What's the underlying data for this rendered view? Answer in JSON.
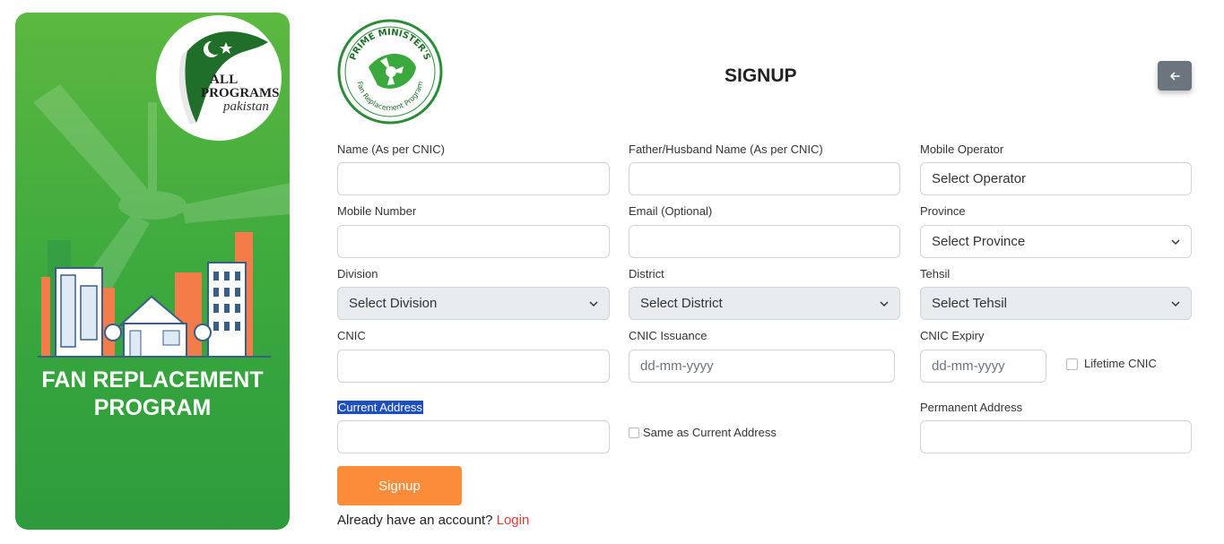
{
  "sidebar": {
    "logo_line1": "ALL",
    "logo_line2": "PROGRAMS",
    "logo_line3": "pakistan",
    "title_line1": "FAN REPLACEMENT",
    "title_line2": "PROGRAM"
  },
  "brand": {
    "ring_top": "PRIME MINISTER'S",
    "ring_bottom": "Fan Replacement Program"
  },
  "header": {
    "title": "SIGNUP",
    "back_icon": "arrow-left-icon"
  },
  "form": {
    "name_label": "Name (As per CNIC)",
    "father_label": "Father/Husband Name (As per CNIC)",
    "operator_label": "Mobile Operator",
    "operator_value": "Select Operator",
    "mobile_label": "Mobile Number",
    "email_label": "Email (Optional)",
    "province_label": "Province",
    "province_value": "Select Province",
    "division_label": "Division",
    "division_value": "Select Division",
    "district_label": "District",
    "district_value": "Select District",
    "tehsil_label": "Tehsil",
    "tehsil_value": "Select Tehsil",
    "cnic_label": "CNIC",
    "cnic_issuance_label": "CNIC Issuance",
    "cnic_issuance_placeholder": "dd-mm-yyyy",
    "cnic_expiry_label": "CNIC Expiry",
    "cnic_expiry_placeholder": "dd-mm-yyyy",
    "lifetime_label": "Lifetime CNIC",
    "current_address_label": "Current Address",
    "same_as_label": "Same as Current Address",
    "permanent_address_label": "Permanent Address"
  },
  "actions": {
    "signup_label": "Signup",
    "login_prompt": "Already have an account?",
    "login_link": "Login"
  },
  "colors": {
    "green": "#3aa83d",
    "orange": "#fb8c3a",
    "back_button": "#6c757d",
    "login_link": "#e53935"
  }
}
